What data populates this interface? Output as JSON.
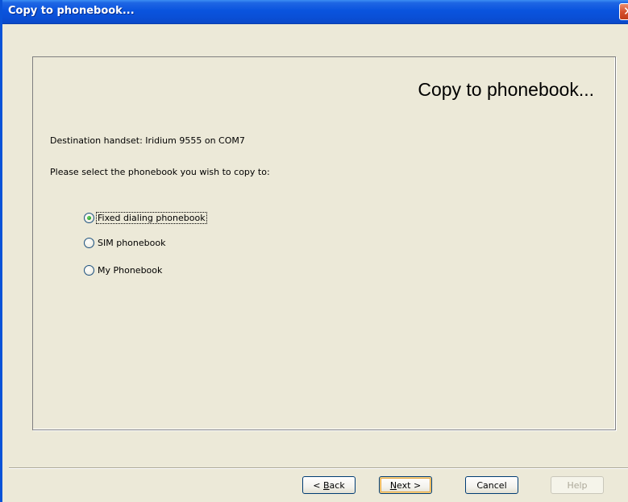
{
  "window": {
    "title": "Copy to phonebook...",
    "close_glyph": "✕"
  },
  "panel": {
    "heading": "Copy to phonebook...",
    "destination_text": "Destination handset: Iridium 9555 on COM7",
    "instruction_text": "Please select the phonebook you wish to copy to:",
    "options": [
      {
        "label": "Fixed dialing phonebook",
        "selected": true
      },
      {
        "label": "SIM phonebook",
        "selected": false
      },
      {
        "label": "My Phonebook",
        "selected": false
      }
    ]
  },
  "buttons": {
    "back": {
      "mnemonic": "B",
      "rest": "ack",
      "prefix": "< "
    },
    "next": {
      "mnemonic": "N",
      "rest": "ext >"
    },
    "cancel": "Cancel",
    "help": "Help"
  },
  "colors": {
    "titlebar": "#0A54DE",
    "dialog_bg": "#ECE9D8",
    "close_button": "#D6502F"
  }
}
